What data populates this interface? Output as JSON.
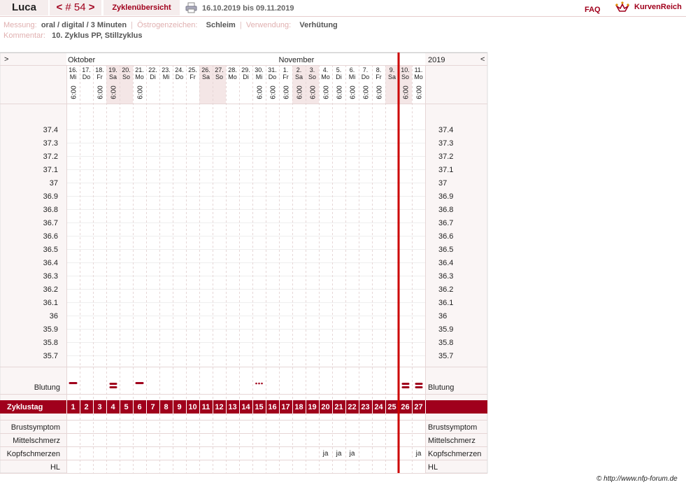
{
  "header": {
    "name": "Luca",
    "cycle_prev": "<",
    "cycle_number": "# 54",
    "cycle_next": ">",
    "overview": "Zyklenübersicht",
    "date_range": "16.10.2019 bis 09.11.2019",
    "faq": "FAQ",
    "brand": "KurvenReich"
  },
  "info": {
    "messung_label": "Messung:",
    "messung_value": "oral / digital / 3 Minuten",
    "oestrogen_label": "Östrogenzeichen:",
    "oestrogen_value": "Schleim",
    "verwendung_label": "Verwendung:",
    "verwendung_value": "Verhütung",
    "kommentar_label": "Kommentar:",
    "kommentar_value": "10. Zyklus PP, Stillzyklus"
  },
  "chart": {
    "nav_prev": ">",
    "nav_next": "<",
    "month_oct": "Oktober",
    "month_nov": "November",
    "year": "2019",
    "days": [
      {
        "date": "16.",
        "dow": "Mi",
        "time": "6:00",
        "shade": false
      },
      {
        "date": "17.",
        "dow": "Do",
        "time": "",
        "shade": false
      },
      {
        "date": "18.",
        "dow": "Fr",
        "time": "6:00",
        "shade": false
      },
      {
        "date": "19.",
        "dow": "Sa",
        "time": "6:00",
        "shade": true
      },
      {
        "date": "20.",
        "dow": "So",
        "time": "",
        "shade": true
      },
      {
        "date": "21.",
        "dow": "Mo",
        "time": "6:00",
        "shade": false
      },
      {
        "date": "22.",
        "dow": "Di",
        "time": "",
        "shade": false
      },
      {
        "date": "23.",
        "dow": "Mi",
        "time": "",
        "shade": false
      },
      {
        "date": "24.",
        "dow": "Do",
        "time": "",
        "shade": false
      },
      {
        "date": "25.",
        "dow": "Fr",
        "time": "",
        "shade": false
      },
      {
        "date": "26.",
        "dow": "Sa",
        "time": "",
        "shade": true
      },
      {
        "date": "27.",
        "dow": "So",
        "time": "",
        "shade": true
      },
      {
        "date": "28.",
        "dow": "Mo",
        "time": "",
        "shade": false
      },
      {
        "date": "29.",
        "dow": "Di",
        "time": "",
        "shade": false
      },
      {
        "date": "30.",
        "dow": "Mi",
        "time": "6:00",
        "shade": false
      },
      {
        "date": "31.",
        "dow": "Do",
        "time": "6:00",
        "shade": false
      },
      {
        "date": "1.",
        "dow": "Fr",
        "time": "6:00",
        "shade": false
      },
      {
        "date": "2.",
        "dow": "Sa",
        "time": "6:00",
        "shade": true
      },
      {
        "date": "3.",
        "dow": "So",
        "time": "6:00",
        "shade": true
      },
      {
        "date": "4.",
        "dow": "Mo",
        "time": "6:00",
        "shade": false
      },
      {
        "date": "5.",
        "dow": "Di",
        "time": "6:00",
        "shade": false
      },
      {
        "date": "6.",
        "dow": "Mi",
        "time": "6:00",
        "shade": false
      },
      {
        "date": "7.",
        "dow": "Do",
        "time": "6:00",
        "shade": false
      },
      {
        "date": "8.",
        "dow": "Fr",
        "time": "6:00",
        "shade": false
      },
      {
        "date": "9.",
        "dow": "Sa",
        "time": "",
        "shade": true
      },
      {
        "date": "10.",
        "dow": "So",
        "time": "6:00",
        "shade": true
      },
      {
        "date": "11.",
        "dow": "Mo",
        "time": "6:00",
        "shade": false
      }
    ],
    "temperature_labels": [
      "37.4",
      "37.3",
      "37.2",
      "37.1",
      "37",
      "36.9",
      "36.8",
      "36.7",
      "36.6",
      "36.5",
      "36.4",
      "36.3",
      "36.2",
      "36.1",
      "36",
      "35.9",
      "35.8",
      "35.7"
    ],
    "bleeding_label": "Blutung",
    "bleeding": [
      {
        "day": 1,
        "type": "single"
      },
      {
        "day": 4,
        "type": "double"
      },
      {
        "day": 6,
        "type": "single"
      },
      {
        "day": 15,
        "type": "dots"
      },
      {
        "day": 26,
        "type": "double"
      },
      {
        "day": 27,
        "type": "double"
      }
    ],
    "cycle_day_label": "Zyklustag",
    "cycle_days": [
      "1",
      "2",
      "3",
      "4",
      "5",
      "6",
      "7",
      "8",
      "9",
      "10",
      "11",
      "12",
      "13",
      "14",
      "15",
      "16",
      "17",
      "18",
      "19",
      "20",
      "21",
      "22",
      "23",
      "24",
      "25",
      "26",
      "27"
    ],
    "symptom_rows": [
      {
        "label": "Brustsymptom",
        "values": {}
      },
      {
        "label": "Mittelschmerz",
        "values": {}
      },
      {
        "label": "Kopfschmerzen",
        "values": {
          "20": "ja",
          "21": "ja",
          "22": "ja",
          "27": "ja"
        }
      },
      {
        "label": "HL",
        "values": {}
      }
    ],
    "cycle_start_after_day": 25
  },
  "footer": "© http://www.nfp-forum.de",
  "colors": {
    "accent": "#a0001c",
    "shade": "#f4e6e6",
    "panel": "#faf5f5",
    "grid": "#e6d6d6"
  }
}
